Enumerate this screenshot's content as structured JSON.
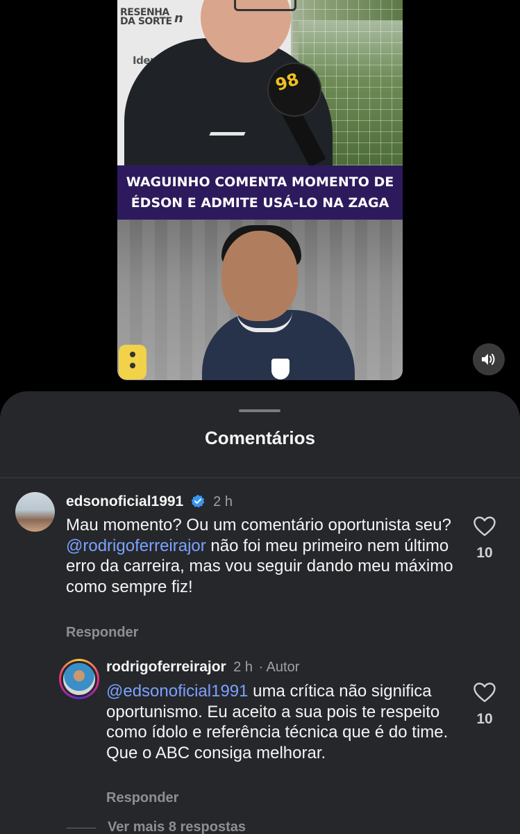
{
  "video": {
    "sponsor_line1": "RESENHA",
    "sponsor_line2": "DA SORTE",
    "sponsor_brand": "n",
    "sponsor_brand2": "Identy",
    "mic_logo": "98",
    "headline_line1": "WAGUINHO COMENTA MOMENTO DE",
    "headline_line2": "ÉDSON E ADMITE USÁ-LO NA ZAGA",
    "sound_icon": "speaker-icon"
  },
  "sheet": {
    "title": "Comentários"
  },
  "comments": [
    {
      "username": "edsonoficial1991",
      "verified": true,
      "time": "2 h",
      "text_part1": "Mau momento? Ou um comentário oportunista seu? ",
      "mention": "@rodrigoferreirajor",
      "text_part2": " não foi meu primeiro nem último erro da carreira, mas vou seguir dando meu máximo como sempre fiz!",
      "likes": "10",
      "reply_label": "Responder"
    },
    {
      "username": "rodrigoferreirajor",
      "time": "2 h",
      "author_tag": "· Autor",
      "mention": "@edsonoficial1991",
      "text_part1": " uma crítica não significa oportunismo. Eu aceito a sua pois te respeito como ídolo e referência técnica que é do time. Que o ABC consiga melhorar.",
      "likes": "10",
      "reply_label": "Responder"
    }
  ],
  "more_replies": "Ver mais 8 respostas",
  "colors": {
    "sheet_bg": "#26272b",
    "mention": "#7aa2ff",
    "verified": "#3897f0",
    "headline_bg": "#2d1a5c"
  }
}
